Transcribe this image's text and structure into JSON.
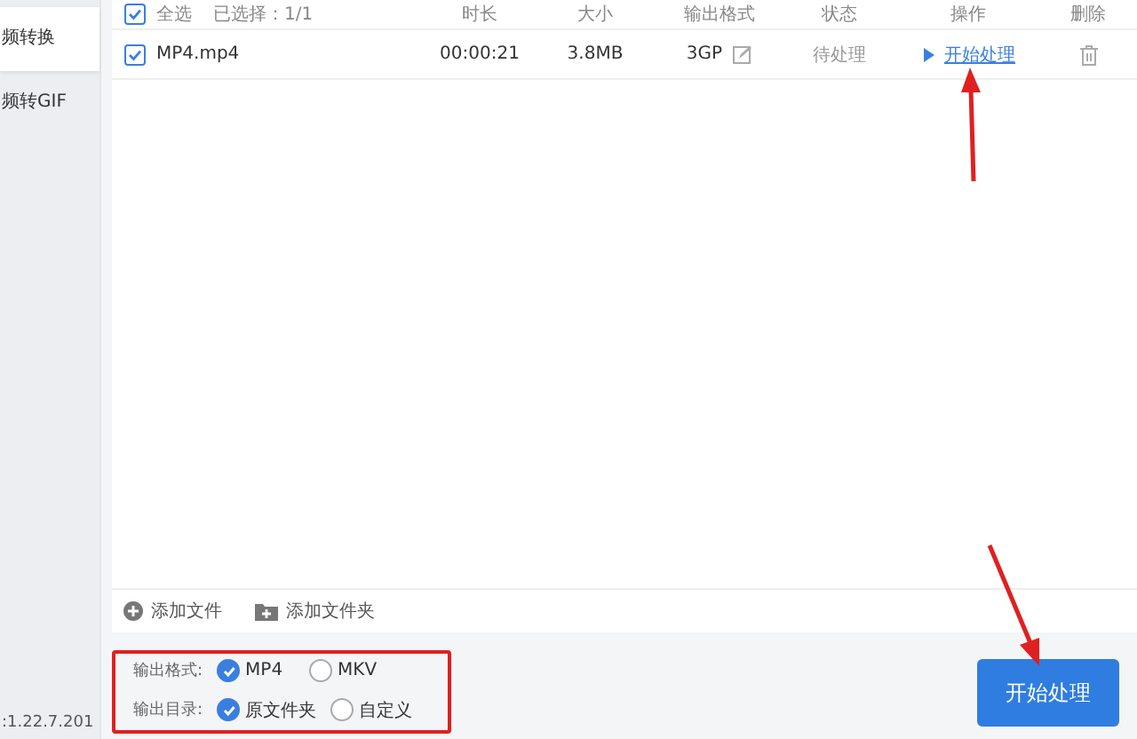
{
  "sidebar": {
    "items": [
      {
        "label": "频转换",
        "selected": true
      },
      {
        "label": "频转GIF",
        "selected": false
      }
    ],
    "version": ":1.22.7.201"
  },
  "table": {
    "select_all": {
      "label": "全选",
      "checked": true
    },
    "selection_count": "已选择：1/1",
    "columns": [
      "时长",
      "大小",
      "输出格式",
      "状态",
      "操作",
      "删除"
    ],
    "rows": [
      {
        "name": "MP4.mp4",
        "checked": true,
        "duration": "00:00:21",
        "size": "3.8MB",
        "format": "3GP",
        "status": "待处理",
        "action": "开始处理"
      }
    ]
  },
  "toolbar": [
    {
      "label": "添加文件",
      "kind": "file"
    },
    {
      "label": "添加文件夹",
      "kind": "folder"
    }
  ],
  "options": [
    {
      "label": "输出格式:",
      "choices": [
        {
          "label": "MP4",
          "selected": true
        },
        {
          "label": "MKV",
          "selected": false
        }
      ]
    },
    {
      "label": "输出目录:",
      "choices": [
        {
          "label": "原文件夹",
          "selected": true
        },
        {
          "label": "自定义",
          "selected": false
        }
      ]
    }
  ],
  "start_button": "开始处理"
}
